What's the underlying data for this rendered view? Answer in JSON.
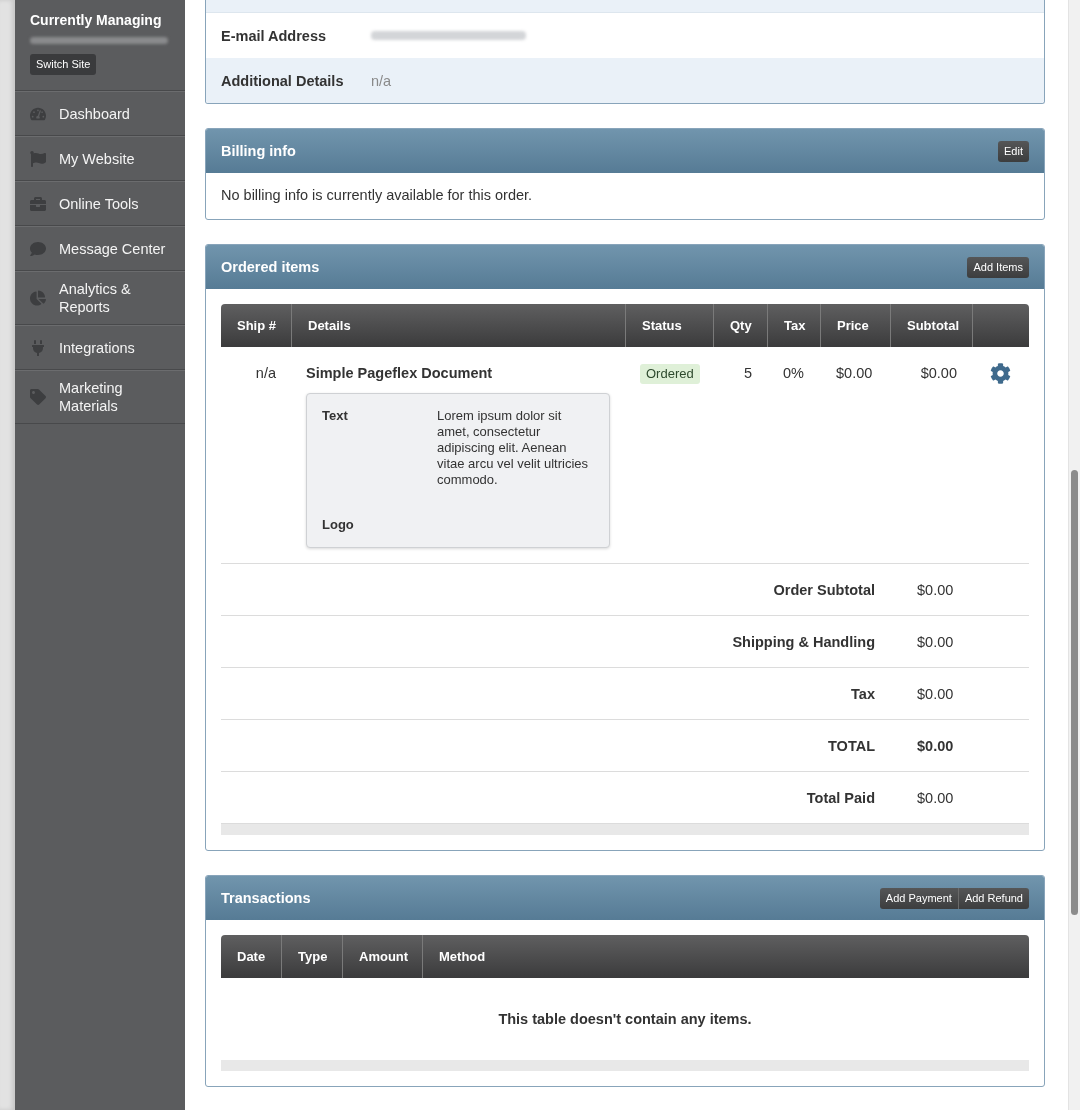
{
  "sidebar": {
    "heading": "Currently Managing",
    "switch_button": "Switch Site",
    "items": [
      {
        "label": "Dashboard",
        "selected": false
      },
      {
        "label": "My Website",
        "selected": false
      },
      {
        "label": "Online Tools",
        "selected": false
      },
      {
        "label": "Message Center",
        "selected": false
      },
      {
        "label": "Analytics & Reports",
        "selected": false
      },
      {
        "label": "Integrations",
        "selected": false
      },
      {
        "label": "Marketing Materials",
        "selected": false
      }
    ]
  },
  "contact_details": {
    "rows": [
      {
        "kind": "redacted",
        "label": "E-mail Address"
      },
      {
        "kind": "text",
        "label": "Additional Details",
        "value": "n/a"
      }
    ]
  },
  "billing_info": {
    "title": "Billing info",
    "button": "Edit",
    "message": "No billing info is currently available for this order."
  },
  "ordered_items": {
    "title": "Ordered items",
    "button": "Add Items",
    "columns": [
      "Ship #",
      "Details",
      "Status",
      "Qty",
      "Tax",
      "Price",
      "Subtotal"
    ],
    "rows": [
      {
        "ship": "n/a",
        "name": "Simple Pageflex Document",
        "fields": [
          {
            "label": "Text",
            "value": "Lorem ipsum dolor sit amet, consectetur adipiscing elit. Aenean vitae arcu vel velit ultricies commodo."
          },
          {
            "label": "Logo"
          }
        ],
        "status": "Ordered",
        "qty": "5",
        "tax": "0%",
        "price": "$0.00",
        "subtotal": "$0.00"
      }
    ],
    "summary": [
      {
        "label": "Order Subtotal",
        "value": "$0.00",
        "bold": false
      },
      {
        "label": "Shipping & Handling",
        "value": "$0.00",
        "bold": false
      },
      {
        "label": "Tax",
        "value": "$0.00",
        "bold": false
      },
      {
        "label": "TOTAL",
        "value": "$0.00",
        "bold": true
      },
      {
        "label": "Total Paid",
        "value": "$0.00",
        "bold": false
      }
    ]
  },
  "transactions": {
    "title": "Transactions",
    "buttons": [
      "Add Payment",
      "Add Refund"
    ],
    "columns": [
      "Date",
      "Type",
      "Amount",
      "Method"
    ],
    "empty_message": "This table doesn't contain any items."
  }
}
